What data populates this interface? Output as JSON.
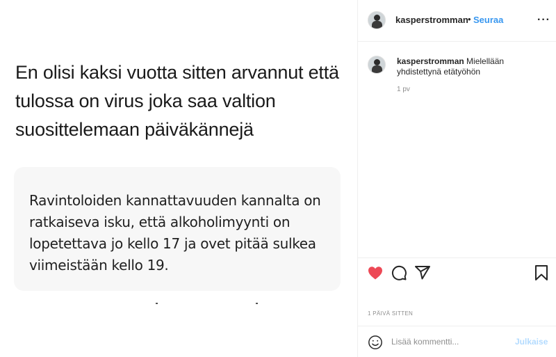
{
  "post": {
    "headline": "En olisi kaksi vuotta sitten arvannut että tulossa on virus joka saa valtion suosittelemaan päiväkännejä",
    "quote": "Ravintoloiden kannattavuuden kannalta on ratkaiseva isku, että alkoholimyynti on lopetettava jo kello 17 ja ovet pitää sulkea viimeistään kello 19."
  },
  "header": {
    "username": "kasperstromman",
    "separator": "•",
    "follow_label": "Seuraa",
    "more_label": "···"
  },
  "caption": {
    "username": "kasperstromman",
    "text": " Mielellään yhdistettynä etätyöhön",
    "time": "1 pv"
  },
  "actions": {
    "like_color": "#ed4956",
    "icons": [
      "heart-icon",
      "comment-icon",
      "share-icon",
      "bookmark-icon"
    ]
  },
  "likes_time": "1 PÄIVÄ SITTEN",
  "comment_box": {
    "placeholder": "Lisää kommentti...",
    "post_label": "Julkaise"
  },
  "colors": {
    "accent": "#3897f0",
    "post_button_disabled": "#b3dbff"
  }
}
